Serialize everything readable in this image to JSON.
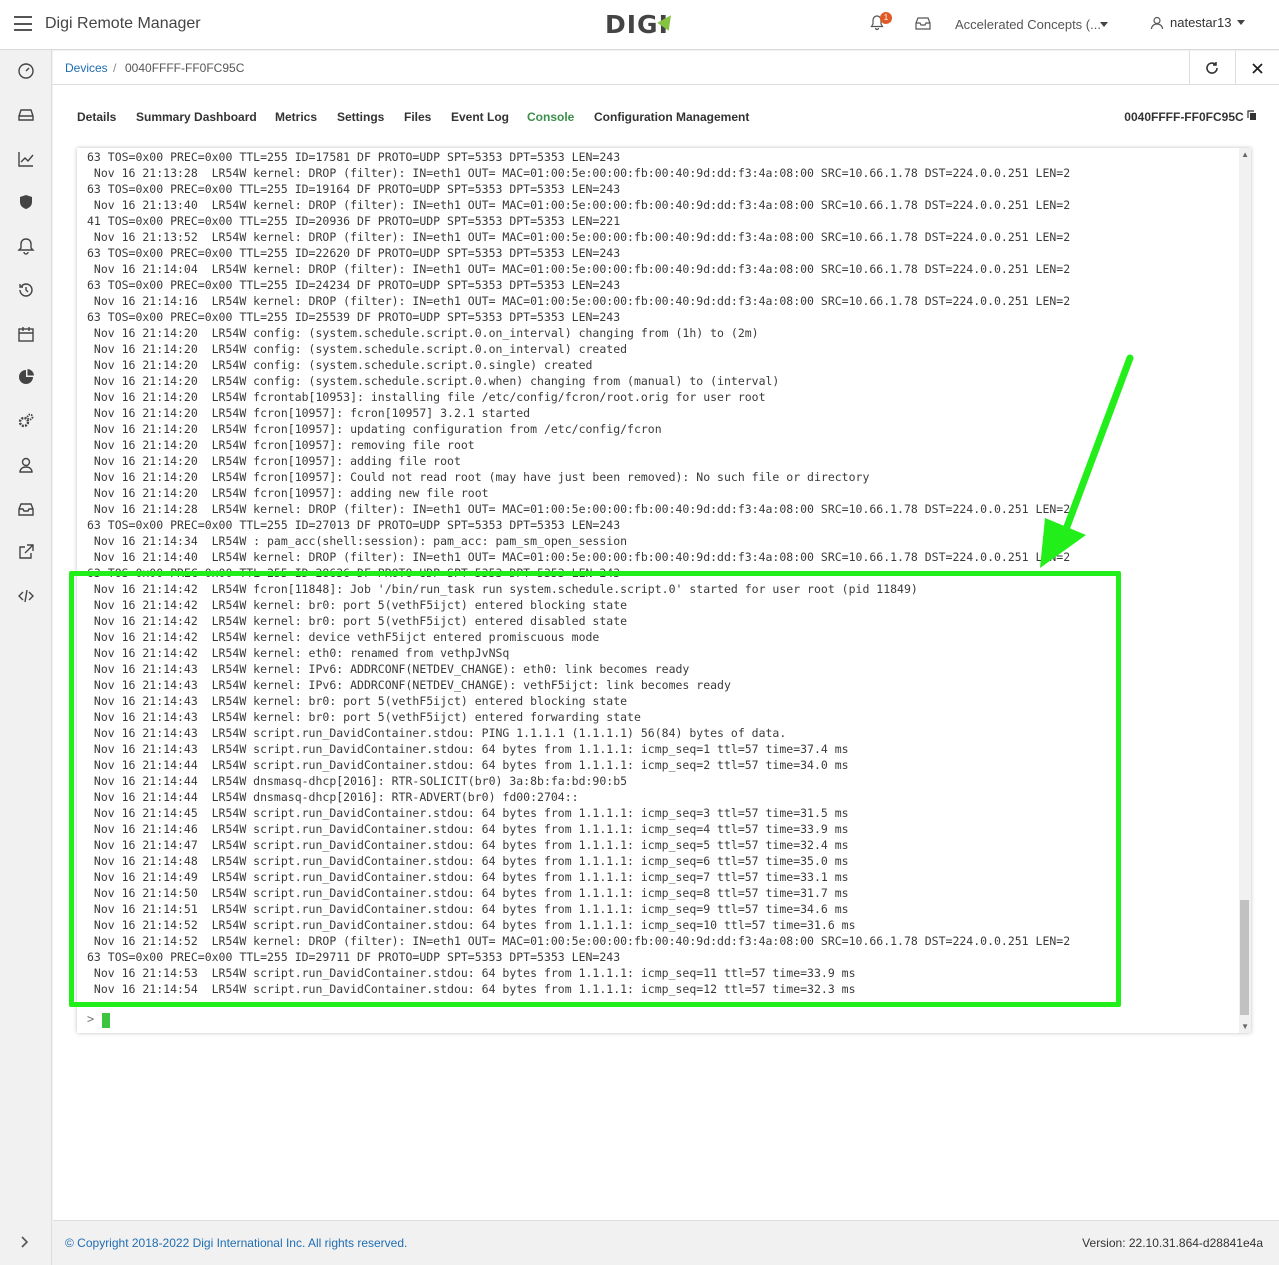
{
  "header": {
    "app_title": "Digi Remote Manager",
    "logo_text": "DIGI",
    "notification_count": "1",
    "account": "Accelerated Concepts (...",
    "user": "natestar13"
  },
  "breadcrumb": {
    "parent": "Devices",
    "separator": "/",
    "current": "0040FFFF-FF0FC95C"
  },
  "tabs": [
    {
      "label": "Details"
    },
    {
      "label": "Summary Dashboard"
    },
    {
      "label": "Metrics"
    },
    {
      "label": "Settings"
    },
    {
      "label": "Files"
    },
    {
      "label": "Event Log"
    },
    {
      "label": "Console",
      "active": true
    },
    {
      "label": "Configuration Management"
    }
  ],
  "device_id": "0040FFFF-FF0FC95C",
  "console": {
    "prompt": ">",
    "lines": [
      "63 TOS=0x00 PREC=0x00 TTL=255 ID=17581 DF PROTO=UDP SPT=5353 DPT=5353 LEN=243",
      " Nov 16 21:13:28  LR54W kernel: DROP (filter): IN=eth1 OUT= MAC=01:00:5e:00:00:fb:00:40:9d:dd:f3:4a:08:00 SRC=10.66.1.78 DST=224.0.0.251 LEN=2",
      "63 TOS=0x00 PREC=0x00 TTL=255 ID=19164 DF PROTO=UDP SPT=5353 DPT=5353 LEN=243",
      " Nov 16 21:13:40  LR54W kernel: DROP (filter): IN=eth1 OUT= MAC=01:00:5e:00:00:fb:00:40:9d:dd:f3:4a:08:00 SRC=10.66.1.78 DST=224.0.0.251 LEN=2",
      "41 TOS=0x00 PREC=0x00 TTL=255 ID=20936 DF PROTO=UDP SPT=5353 DPT=5353 LEN=221",
      " Nov 16 21:13:52  LR54W kernel: DROP (filter): IN=eth1 OUT= MAC=01:00:5e:00:00:fb:00:40:9d:dd:f3:4a:08:00 SRC=10.66.1.78 DST=224.0.0.251 LEN=2",
      "63 TOS=0x00 PREC=0x00 TTL=255 ID=22620 DF PROTO=UDP SPT=5353 DPT=5353 LEN=243",
      " Nov 16 21:14:04  LR54W kernel: DROP (filter): IN=eth1 OUT= MAC=01:00:5e:00:00:fb:00:40:9d:dd:f3:4a:08:00 SRC=10.66.1.78 DST=224.0.0.251 LEN=2",
      "63 TOS=0x00 PREC=0x00 TTL=255 ID=24234 DF PROTO=UDP SPT=5353 DPT=5353 LEN=243",
      " Nov 16 21:14:16  LR54W kernel: DROP (filter): IN=eth1 OUT= MAC=01:00:5e:00:00:fb:00:40:9d:dd:f3:4a:08:00 SRC=10.66.1.78 DST=224.0.0.251 LEN=2",
      "63 TOS=0x00 PREC=0x00 TTL=255 ID=25539 DF PROTO=UDP SPT=5353 DPT=5353 LEN=243",
      " Nov 16 21:14:20  LR54W config: (system.schedule.script.0.on_interval) changing from (1h) to (2m)",
      " Nov 16 21:14:20  LR54W config: (system.schedule.script.0.on_interval) created",
      " Nov 16 21:14:20  LR54W config: (system.schedule.script.0.single) created",
      " Nov 16 21:14:20  LR54W config: (system.schedule.script.0.when) changing from (manual) to (interval)",
      " Nov 16 21:14:20  LR54W fcrontab[10953]: installing file /etc/config/fcron/root.orig for user root",
      " Nov 16 21:14:20  LR54W fcron[10957]: fcron[10957] 3.2.1 started",
      " Nov 16 21:14:20  LR54W fcron[10957]: updating configuration from /etc/config/fcron",
      " Nov 16 21:14:20  LR54W fcron[10957]: removing file root",
      " Nov 16 21:14:20  LR54W fcron[10957]: adding file root",
      " Nov 16 21:14:20  LR54W fcron[10957]: Could not read root (may have just been removed): No such file or directory",
      " Nov 16 21:14:20  LR54W fcron[10957]: adding new file root",
      " Nov 16 21:14:28  LR54W kernel: DROP (filter): IN=eth1 OUT= MAC=01:00:5e:00:00:fb:00:40:9d:dd:f3:4a:08:00 SRC=10.66.1.78 DST=224.0.0.251 LEN=2",
      "63 TOS=0x00 PREC=0x00 TTL=255 ID=27013 DF PROTO=UDP SPT=5353 DPT=5353 LEN=243",
      " Nov 16 21:14:34  LR54W : pam_acc(shell:session): pam_acc: pam_sm_open_session",
      " Nov 16 21:14:40  LR54W kernel: DROP (filter): IN=eth1 OUT= MAC=01:00:5e:00:00:fb:00:40:9d:dd:f3:4a:08:00 SRC=10.66.1.78 DST=224.0.0.251 LEN=2",
      "63 TOS=0x00 PREC=0x00 TTL=255 ID=28636 DF PROTO=UDP SPT=5353 DPT=5353 LEN=243",
      " Nov 16 21:14:42  LR54W fcron[11848]: Job '/bin/run_task run system.schedule.script.0' started for user root (pid 11849)",
      " Nov 16 21:14:42  LR54W kernel: br0: port 5(vethF5ijct) entered blocking state",
      " Nov 16 21:14:42  LR54W kernel: br0: port 5(vethF5ijct) entered disabled state",
      " Nov 16 21:14:42  LR54W kernel: device vethF5ijct entered promiscuous mode",
      " Nov 16 21:14:42  LR54W kernel: eth0: renamed from vethpJvNSq",
      " Nov 16 21:14:43  LR54W kernel: IPv6: ADDRCONF(NETDEV_CHANGE): eth0: link becomes ready",
      " Nov 16 21:14:43  LR54W kernel: IPv6: ADDRCONF(NETDEV_CHANGE): vethF5ijct: link becomes ready",
      " Nov 16 21:14:43  LR54W kernel: br0: port 5(vethF5ijct) entered blocking state",
      " Nov 16 21:14:43  LR54W kernel: br0: port 5(vethF5ijct) entered forwarding state",
      " Nov 16 21:14:43  LR54W script.run_DavidContainer.stdou: PING 1.1.1.1 (1.1.1.1) 56(84) bytes of data.",
      " Nov 16 21:14:43  LR54W script.run_DavidContainer.stdou: 64 bytes from 1.1.1.1: icmp_seq=1 ttl=57 time=37.4 ms",
      " Nov 16 21:14:44  LR54W script.run_DavidContainer.stdou: 64 bytes from 1.1.1.1: icmp_seq=2 ttl=57 time=34.0 ms",
      " Nov 16 21:14:44  LR54W dnsmasq-dhcp[2016]: RTR-SOLICIT(br0) 3a:8b:fa:bd:90:b5",
      " Nov 16 21:14:44  LR54W dnsmasq-dhcp[2016]: RTR-ADVERT(br0) fd00:2704::",
      " Nov 16 21:14:45  LR54W script.run_DavidContainer.stdou: 64 bytes from 1.1.1.1: icmp_seq=3 ttl=57 time=31.5 ms",
      " Nov 16 21:14:46  LR54W script.run_DavidContainer.stdou: 64 bytes from 1.1.1.1: icmp_seq=4 ttl=57 time=33.9 ms",
      " Nov 16 21:14:47  LR54W script.run_DavidContainer.stdou: 64 bytes from 1.1.1.1: icmp_seq=5 ttl=57 time=32.4 ms",
      " Nov 16 21:14:48  LR54W script.run_DavidContainer.stdou: 64 bytes from 1.1.1.1: icmp_seq=6 ttl=57 time=35.0 ms",
      " Nov 16 21:14:49  LR54W script.run_DavidContainer.stdou: 64 bytes from 1.1.1.1: icmp_seq=7 ttl=57 time=33.1 ms",
      " Nov 16 21:14:50  LR54W script.run_DavidContainer.stdou: 64 bytes from 1.1.1.1: icmp_seq=8 ttl=57 time=31.7 ms",
      " Nov 16 21:14:51  LR54W script.run_DavidContainer.stdou: 64 bytes from 1.1.1.1: icmp_seq=9 ttl=57 time=34.6 ms",
      " Nov 16 21:14:52  LR54W script.run_DavidContainer.stdou: 64 bytes from 1.1.1.1: icmp_seq=10 ttl=57 time=31.6 ms",
      " Nov 16 21:14:52  LR54W kernel: DROP (filter): IN=eth1 OUT= MAC=01:00:5e:00:00:fb:00:40:9d:dd:f3:4a:08:00 SRC=10.66.1.78 DST=224.0.0.251 LEN=2",
      "63 TOS=0x00 PREC=0x00 TTL=255 ID=29711 DF PROTO=UDP SPT=5353 DPT=5353 LEN=243",
      " Nov 16 21:14:53  LR54W script.run_DavidContainer.stdou: 64 bytes from 1.1.1.1: icmp_seq=11 ttl=57 time=33.9 ms",
      " Nov 16 21:14:54  LR54W script.run_DavidContainer.stdou: 64 bytes from 1.1.1.1: icmp_seq=12 ttl=57 time=32.3 ms"
    ]
  },
  "footer": {
    "copyright": "© Copyright 2018-2022 Digi International Inc. All rights reserved.",
    "version": "Version: 22.10.31.864-d28841e4a"
  },
  "colors": {
    "accent_green": "#3c8f4a",
    "link_blue": "#1f6db1",
    "annotation_green": "#22ee1a",
    "badge_orange": "#e05a25"
  }
}
